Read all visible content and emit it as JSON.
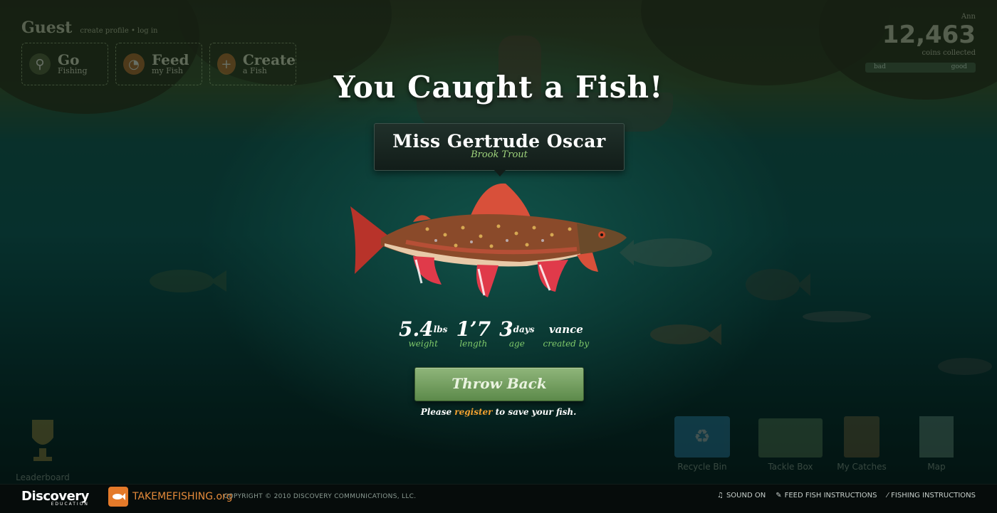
{
  "header": {
    "user": "Guest",
    "user_links": "create profile • log in",
    "score_label": "Ann",
    "score_value": "12,463",
    "score_sub": "coins collected",
    "meter_left": "bad",
    "meter_right": "good"
  },
  "nav": {
    "go_fishing": {
      "title": "Go",
      "sub": "Fishing"
    },
    "feed_fish": {
      "title": "Feed",
      "sub": "my Fish"
    },
    "create_fish": {
      "title": "Create",
      "sub": "a Fish"
    }
  },
  "modal": {
    "headline": "You Caught a Fish!",
    "fish_name": "Miss Gertrude Oscar",
    "fish_species": "Brook Trout",
    "stats": {
      "weight_value": "5.4",
      "weight_unit": "lbs",
      "weight_label": "weight",
      "length_value": "1’7",
      "length_label": "length",
      "age_value": "3",
      "age_unit": "days",
      "age_label": "age",
      "creator_value": "vance",
      "creator_label": "created by"
    },
    "throw_back_label": "Throw Back",
    "register_prefix": "Please ",
    "register_link": "register",
    "register_suffix": " to save your fish."
  },
  "bottom_bar": {
    "leaderboard": "Leaderboard",
    "recycle_bin": "Recycle Bin",
    "tackle_box": "Tackle Box",
    "my_catches": "My Catches",
    "map": "Map"
  },
  "footer": {
    "discovery": "Discovery",
    "discovery_sub": "EDUCATION",
    "takemefishing": "TAKEMEFISHING.org",
    "copyright": "COPYRIGHT © 2010 DISCOVERY COMMUNICATIONS, LLC.",
    "sound": "SOUND ON",
    "feed_instructions": "FEED FISH INSTRUCTIONS",
    "fishing_instructions": "FISHING INSTRUCTIONS"
  },
  "colors": {
    "accent_green": "#9fd47c",
    "register_orange": "#f0a030",
    "button_green": "#5c8a4a"
  }
}
